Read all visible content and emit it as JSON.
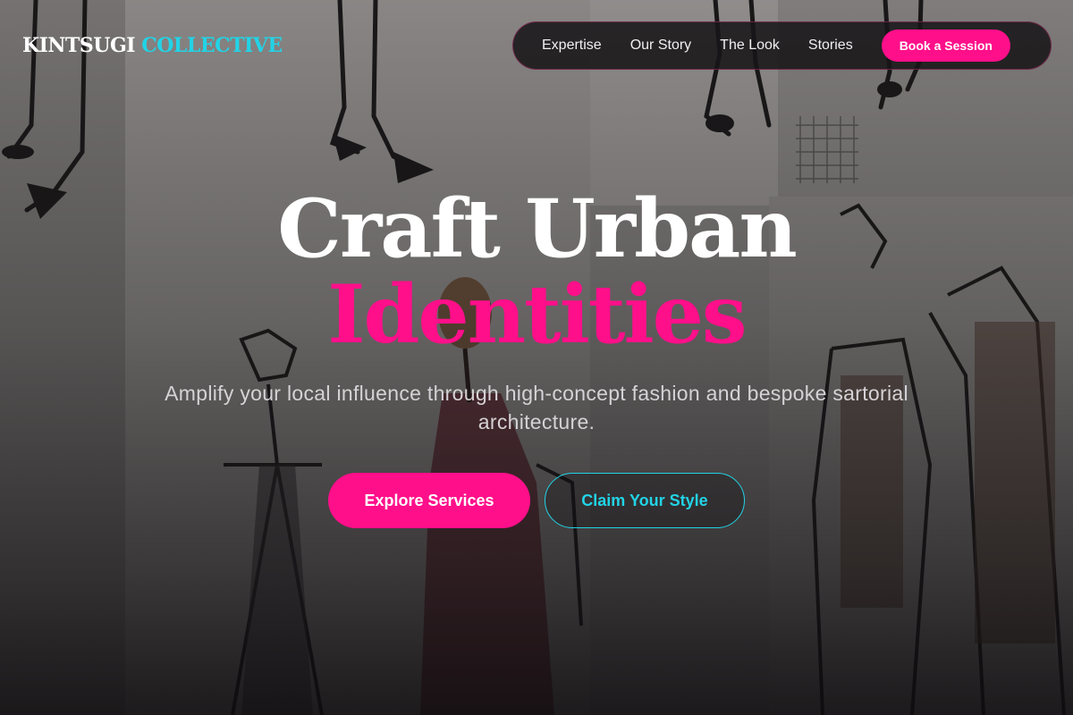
{
  "brand": {
    "word1": "KINTSUGI",
    "word2": "COLLECTIVE"
  },
  "nav": {
    "links": [
      "Expertise",
      "Our Story",
      "The Look",
      "Stories"
    ],
    "cta": "Book a Session"
  },
  "hero": {
    "headline_line1": "Craft Urban",
    "headline_line2": "Identities",
    "subtitle": "Amplify your local influence through high-concept fashion and bespoke sartorial architecture.",
    "primary_button": "Explore Services",
    "secondary_button": "Claim Your Style"
  },
  "colors": {
    "accent_pink": "#ff0f8a",
    "accent_cyan": "#22d3e6",
    "background": "#2c2b2c"
  }
}
